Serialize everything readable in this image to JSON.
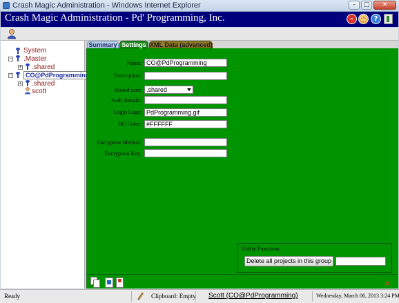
{
  "window": {
    "title": "Crash Magic Administration - Windows Internet Explorer"
  },
  "app": {
    "title": "Crash Magic Administration - Pd' Programming, Inc."
  },
  "tree": {
    "system": "System",
    "master": ".Master",
    "master_shared": ".shared",
    "project": "CO@PdProgramming",
    "project_shared": ".shared",
    "user": "scott"
  },
  "tabs": [
    {
      "label": "Summary"
    },
    {
      "label": "Settings"
    },
    {
      "label": "XML Data (advanced)"
    }
  ],
  "form": {
    "name": {
      "label": "Name:",
      "value": "CO@PdProgramming"
    },
    "description": {
      "label": "Description:",
      "value": ""
    },
    "shared_user": {
      "label": "Shared user:",
      "value": ".shared"
    },
    "auth_domain": {
      "label": "Auth domain:",
      "value": ""
    },
    "login_logo": {
      "label": "Login Logo:",
      "value": "PdProgramming.gif"
    },
    "bg_color": {
      "label": "BG Color:",
      "value": "#FFFFFF"
    },
    "encryption_method": {
      "label": "Encryption Method:",
      "value": ""
    },
    "encryption_key": {
      "label": "Encryption Key:",
      "value": ""
    }
  },
  "utility": {
    "title": "Utility Functions:",
    "delete_button": "Delete all projects in this group",
    "input_value": ""
  },
  "status": {
    "ready": "Ready",
    "clipboard": "Clipboard: Empty",
    "user": "Scott (CO@PdProgramming)",
    "datetime": "Wednesday, March 06, 2013 3:24 PM"
  },
  "colors": {
    "header_bg": "#00007d",
    "panel_green": "#009500",
    "tab_summary": "#b9d0e8",
    "tab_settings": "#1f8a1f",
    "tab_xml": "#8f7a2a"
  },
  "icons": {
    "header": [
      "stop-icon",
      "face-icon",
      "help-icon",
      "exit-icon"
    ],
    "toolbar": [
      "user-icon"
    ],
    "bottom": [
      "copy-icon",
      "new-page-icon",
      "document-icon",
      "close-x-icon"
    ]
  }
}
